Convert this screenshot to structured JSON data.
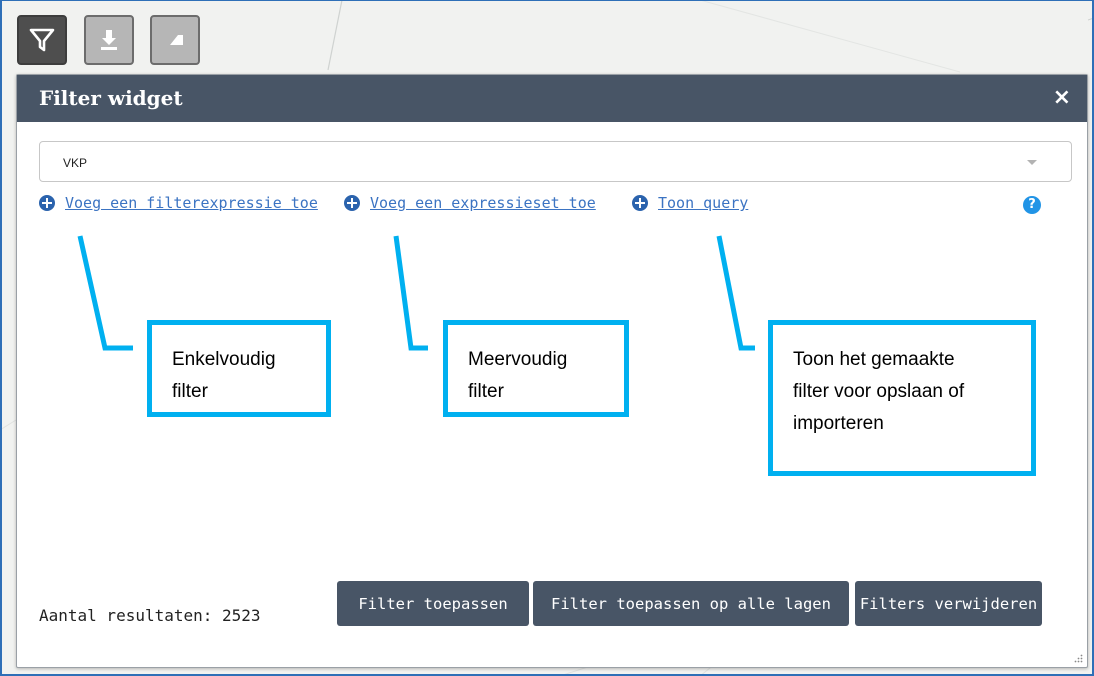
{
  "toolbar": {
    "buttons": [
      {
        "name": "filter-icon",
        "state": "active"
      },
      {
        "name": "download-icon",
        "state": "disabled"
      },
      {
        "name": "eraser-icon",
        "state": "disabled"
      }
    ]
  },
  "panel": {
    "title": "Filter widget",
    "close_label": "×",
    "layer_select": {
      "value": "VKP"
    },
    "links": {
      "add_expression": "Voeg een filterexpressie toe",
      "add_expression_set": "Voeg een expressieset toe",
      "show_query": "Toon query"
    },
    "help_label": "?",
    "result_count": "Aantal resultaten: 2523",
    "buttons": {
      "apply": "Filter toepassen",
      "apply_all": "Filter toepassen op alle lagen",
      "remove": "Filters verwijderen"
    }
  },
  "callouts": {
    "single": {
      "line1": "Enkelvoudig",
      "line2": "filter"
    },
    "multiple": {
      "line1": "Meervoudig",
      "line2": "filter"
    },
    "query": {
      "line1": "Toon het gemaakte",
      "line2": "filter voor opslaan of",
      "line3": "importeren"
    }
  },
  "colors": {
    "header": "#485566",
    "link": "#3b73c2",
    "plus_icon": "#2b63ad",
    "help_icon": "#2194e6",
    "callout": "#00b0f0",
    "frame": "#2e6fb7"
  }
}
